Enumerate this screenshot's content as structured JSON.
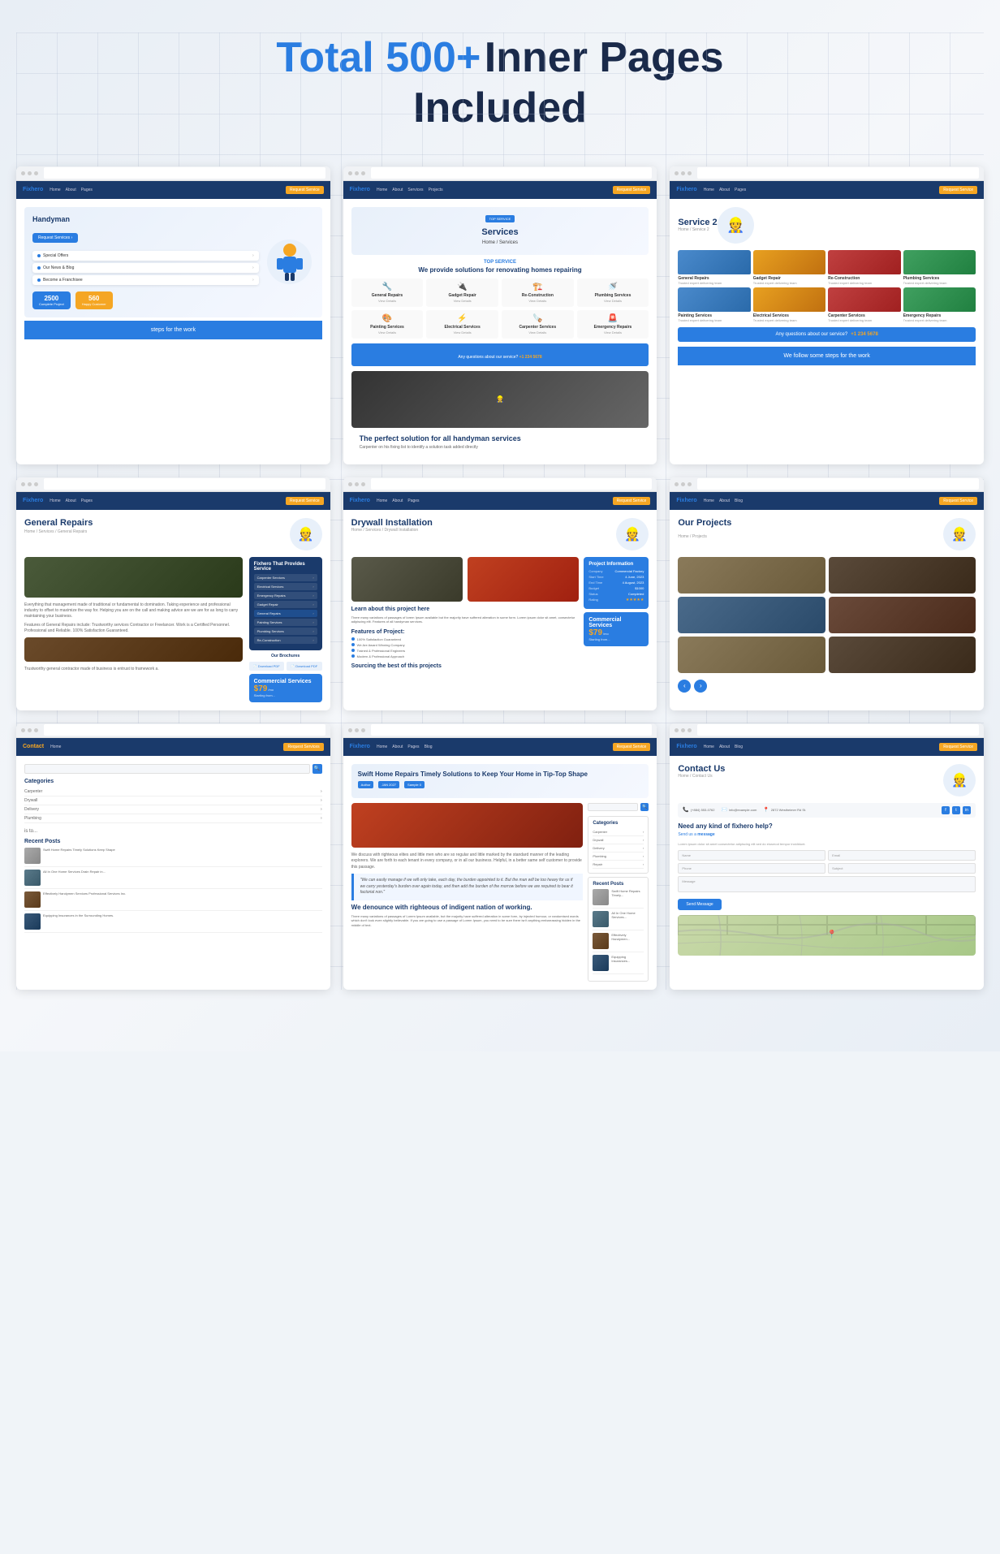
{
  "header": {
    "title_highlight": "Total 500+",
    "title_normal": " Inner Pages",
    "title_line2": "Included"
  },
  "cards": {
    "row1": [
      {
        "id": "handyman",
        "hero_title": "Handyman",
        "menu_items": [
          "Special Offers",
          "Our News & Blog",
          "Become a Franchisee"
        ],
        "stats": [
          {
            "num": "2500",
            "label": "Complete Project"
          },
          {
            "num": "560",
            "label": "Happy Customer"
          }
        ],
        "steps_text": "steps for the work"
      },
      {
        "id": "services",
        "page_title": "Services",
        "breadcrumb": "Home / Services",
        "tag": "TOP SERVICE",
        "sub_text": "We provide solutions for renovating homes repairing",
        "services": [
          {
            "name": "General Repairs",
            "icon": "🔧"
          },
          {
            "name": "Gadget Repair",
            "icon": "🔌"
          },
          {
            "name": "Re-Construction",
            "icon": "🏗️"
          },
          {
            "name": "Plumbing Services",
            "icon": "🚿"
          },
          {
            "name": "Painting Services",
            "icon": "🎨"
          },
          {
            "name": "Electrical Services",
            "icon": "⚡"
          },
          {
            "name": "Carpenter Services",
            "icon": "🪚"
          },
          {
            "name": "Emergency Repairs",
            "icon": "🚨"
          }
        ],
        "cta_text": "Any questions about our service?",
        "cta_phone": "+1 234 5678",
        "bottom_title": "The perfect solution for all handyman services",
        "bottom_text": "Carpenter on his fixing list to identify a solution task added directly that provides solution"
      },
      {
        "id": "service2",
        "page_title": "Service 2",
        "breadcrumb": "Home / Service 2",
        "services": [
          {
            "name": "General Repairs",
            "type": "blue"
          },
          {
            "name": "Gadget Repair",
            "type": "orange"
          },
          {
            "name": "Re-Construction",
            "type": "red"
          },
          {
            "name": "Plumbing Services",
            "type": "green"
          },
          {
            "name": "Painting Services",
            "type": "blue"
          },
          {
            "name": "Electrical Services",
            "type": "orange"
          },
          {
            "name": "Carpenter Services",
            "type": "red"
          },
          {
            "name": "Emergency Repairs",
            "type": "green"
          }
        ],
        "cta_text": "Any questions about our service?",
        "cta_phone": "+1 234 5678",
        "steps_text": "We follow some steps for the work"
      }
    ],
    "row2": [
      {
        "id": "general_repairs",
        "page_title": "General Repairs",
        "breadcrumb": "Home / Services / General Repairs",
        "services_list": [
          "Carpenter Services",
          "Electrical Services",
          "Emergency Repairs",
          "Gadget Repair",
          "General Repairs",
          "Painting Services",
          "Plumbing Services",
          "Re-Construction"
        ],
        "btn_brochures": [
          "Download PDF",
          "Download PDF"
        ],
        "commercial_title": "Commercial Services",
        "commercial_price": "$79",
        "commercial_unit": "/mo"
      },
      {
        "id": "drywall",
        "page_title": "Drywall Installation",
        "breadcrumb": "Home / Services / Drywall Installation",
        "learn_title": "Learn about this project here",
        "features_title": "Features of Project",
        "features": [
          "100% Satisfaction Guaranteed",
          "We Are Award Winning Company",
          "Trained & Professional Engineers",
          "Modern & Professional Approach"
        ],
        "project_info": {
          "title": "Project Information",
          "company": "Commercial Factory",
          "start": "4 June, 2023",
          "end": "4 August, 2023",
          "budget": "$1000",
          "status": "Completed",
          "rating": "★★★★★"
        }
      },
      {
        "id": "projects",
        "page_title": "Our Projects",
        "projects": [
          "industrial",
          "worker",
          "electrical",
          "maintenance"
        ]
      }
    ],
    "row3": [
      {
        "id": "blog",
        "page_title": "Swift Home Repairs Timely Solutions to Keep Your Home in Tip-Top Shape",
        "meta": [
          "Author",
          "JAN 2027",
          "Sample 0"
        ],
        "categories": [
          "Carpenter",
          "Drywall",
          "Delivery",
          "Plumbing"
        ],
        "recent_posts_title": "Recent Posts",
        "bottom_title": "We denounce with righteous of indigent nation of working.",
        "bottom_text": "There many variations of passages of Lorem Ipsum available, but the majority have suffered alteration in some form, by injected humour, or randomised words which do not look even slightly believable."
      },
      {
        "id": "contact",
        "page_title": "Contact Us",
        "breadcrumb": "Home / Contact Us",
        "phone": "(+884) 553-0762",
        "email": "info@example.com",
        "address": "2872 Westheimer Rd St.",
        "form_title": "Need any kind of fixhero help?",
        "form_sub": "Send us a message",
        "fields": [
          "Name",
          "Email",
          "Phone",
          "Subject"
        ],
        "textarea_placeholder": "Message",
        "send_btn": "Send Message"
      }
    ]
  }
}
